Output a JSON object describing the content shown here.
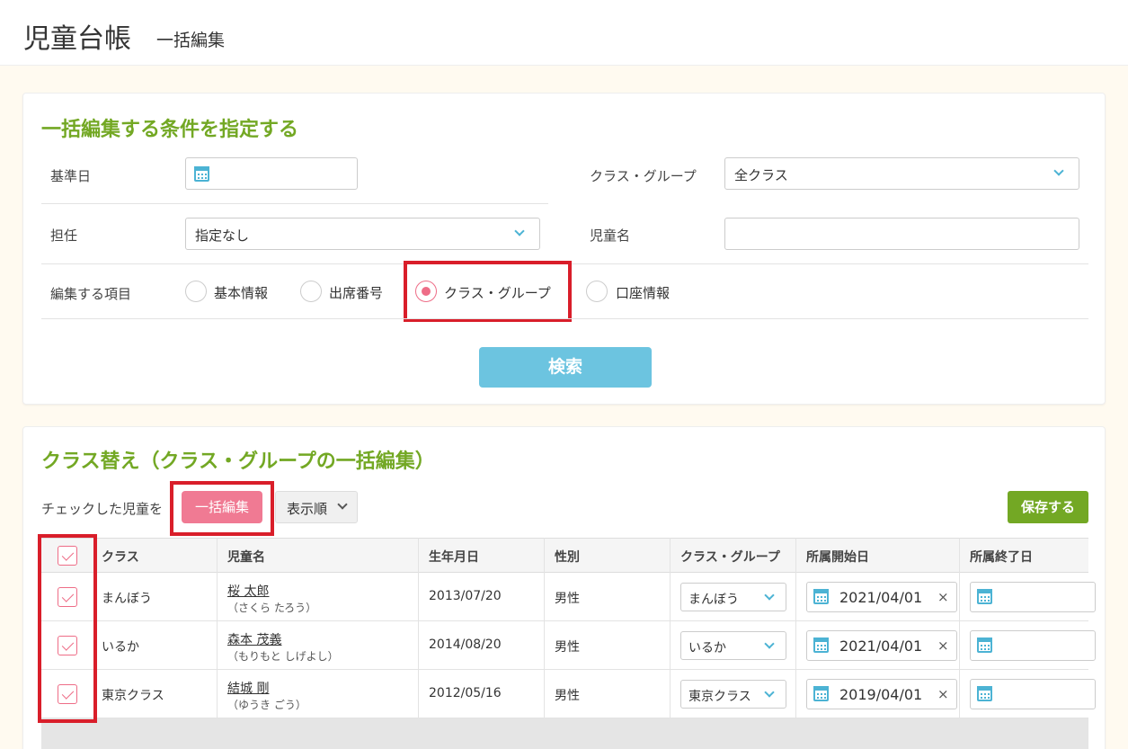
{
  "header": {
    "title": "児童台帳",
    "subtitle": "一括編集"
  },
  "conditions": {
    "title": "一括編集する条件を指定する",
    "base_date_label": "基準日",
    "base_date_value": "",
    "class_group_label": "クラス・グループ",
    "class_group_value": "全クラス",
    "teacher_label": "担任",
    "teacher_value": "指定なし",
    "child_name_label": "児童名",
    "child_name_value": "",
    "edit_item_label": "編集する項目",
    "options": [
      "基本情報",
      "出席番号",
      "クラス・グループ",
      "口座情報"
    ],
    "selected_option": "クラス・グループ",
    "search_label": "検索"
  },
  "bulk": {
    "title": "クラス替え（クラス・グループの一括編集）",
    "checked_text": "チェックした児童を",
    "bulk_edit_label": "一括編集",
    "order_label": "表示順",
    "save_label": "保存する"
  },
  "table": {
    "columns": [
      "クラス",
      "児童名",
      "生年月日",
      "性別",
      "クラス・グループ",
      "所属開始日",
      "所属終了日"
    ],
    "rows": [
      {
        "class": "まんぼう",
        "name": "桜 太郎",
        "kana": "（さくら たろう）",
        "birth": "2013/07/20",
        "gender": "男性",
        "group": "まんぼう",
        "start": "2021/04/01",
        "end": ""
      },
      {
        "class": "いるか",
        "name": "森本 茂義",
        "kana": "（もりもと しげよし）",
        "birth": "2014/08/20",
        "gender": "男性",
        "group": "いるか",
        "start": "2021/04/01",
        "end": ""
      },
      {
        "class": "東京クラス",
        "name": "結城 剛",
        "kana": "（ゆうき ごう）",
        "birth": "2012/05/16",
        "gender": "男性",
        "group": "東京クラス",
        "start": "2019/04/01",
        "end": ""
      }
    ]
  },
  "colors": {
    "accent_green": "#73a824",
    "accent_pink": "#f07a93",
    "accent_blue": "#6cc4e0",
    "highlight_red": "#d91e2a"
  },
  "icons": [
    "calendar-icon",
    "chevron-down-icon",
    "check-icon",
    "clear-icon"
  ]
}
